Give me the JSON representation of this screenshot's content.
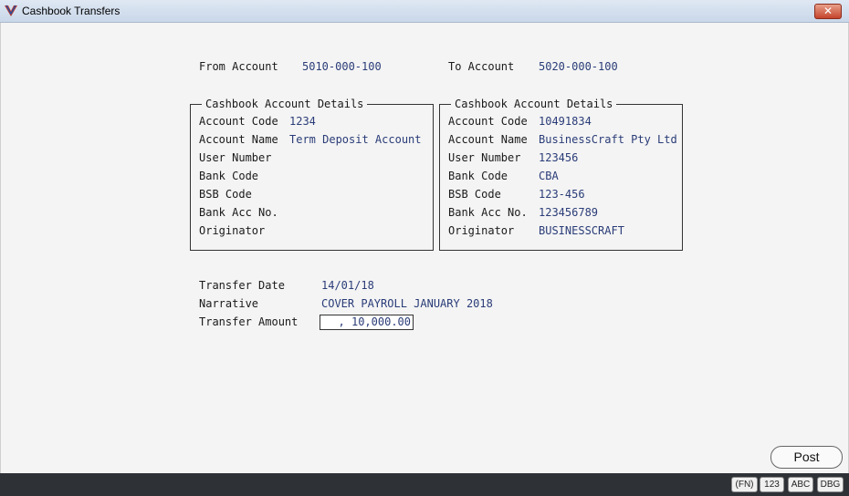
{
  "window": {
    "title": "Cashbook Transfers",
    "close_glyph": "✕"
  },
  "accounts": {
    "from_label": "From Account",
    "from_value": "5010-000-100",
    "to_label": "To Account",
    "to_value": "5020-000-100"
  },
  "from_details": {
    "legend": "Cashbook Account Details",
    "rows": [
      {
        "label": "Account Code",
        "value": "1234"
      },
      {
        "label": "Account Name",
        "value": "Term Deposit Account"
      },
      {
        "label": "User Number",
        "value": ""
      },
      {
        "label": "Bank Code",
        "value": ""
      },
      {
        "label": "BSB Code",
        "value": ""
      },
      {
        "label": "Bank Acc No.",
        "value": ""
      },
      {
        "label": "Originator",
        "value": ""
      }
    ]
  },
  "to_details": {
    "legend": "Cashbook Account Details",
    "rows": [
      {
        "label": "Account Code",
        "value": "10491834"
      },
      {
        "label": "Account Name",
        "value": "BusinessCraft Pty Ltd"
      },
      {
        "label": "User Number",
        "value": "123456"
      },
      {
        "label": "Bank Code",
        "value": "CBA"
      },
      {
        "label": "BSB Code",
        "value": "123-456"
      },
      {
        "label": "Bank Acc No.",
        "value": "123456789"
      },
      {
        "label": "Originator",
        "value": "BUSINESSCRAFT"
      }
    ]
  },
  "transfer": {
    "date_label": "Transfer Date",
    "date_value": "14/01/18",
    "narrative_label": "Narrative",
    "narrative_value": "COVER PAYROLL JANUARY 2018",
    "amount_label": "Transfer Amount",
    "amount_value": ", 10,000.00"
  },
  "actions": {
    "post_label": "Post"
  },
  "statusbar": {
    "buttons": [
      "(FN)",
      "123",
      "ABC",
      "DBG"
    ]
  },
  "colors": {
    "value_text": "#2a3c78",
    "statusbar_bg": "#2e3237",
    "title_gradient": "#c9d7e9",
    "close_red": "#c5432b"
  }
}
